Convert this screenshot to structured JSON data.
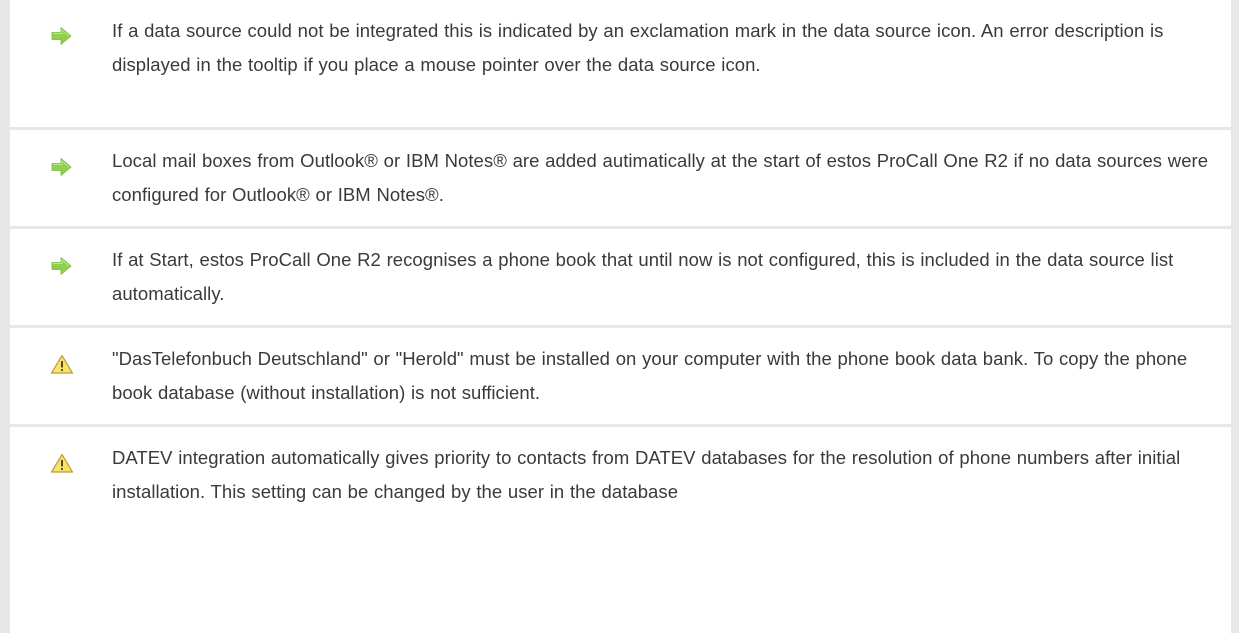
{
  "notes": [
    {
      "type": "info",
      "icon": "green-arrow-icon",
      "text": "If a data source could not be integrated  this is indicated by an exclamation mark in the data source icon. An error description  is displayed  in the tooltip  if you place a mouse pointer over the data source icon."
    },
    {
      "type": "info",
      "icon": "green-arrow-icon",
      "text": "Local mail boxes from Outlook® or IBM Notes®  are added autimatically at the start of estos ProCall One R2  if no data sources were configured for Outlook® or IBM Notes®."
    },
    {
      "type": "info",
      "icon": "green-arrow-icon",
      "text": "If at Start, estos ProCall One R2 recognises a phone book  that until now is not configured, this is included in the data source list automatically."
    },
    {
      "type": "warning",
      "icon": "warning-triangle-icon",
      "text": "\"DasTelefonbuch  Deutschland\"  or  \"Herold\"  must be installed on your computer with the phone book data bank. To copy the phone book database  (without installation)  is not sufficient."
    },
    {
      "type": "warning",
      "icon": "warning-triangle-icon",
      "text": "DATEV integration automatically gives priority to contacts from DATEV databases for the resolution of phone numbers after initial installation.  This setting can be changed by the user in the database"
    }
  ],
  "colors": {
    "arrow_fill": "#8fd14f",
    "warning_fill": "#f7e36a",
    "warning_stroke": "#b89a3a",
    "separator": "#e7e7e7",
    "text": "#3a3a3a"
  }
}
